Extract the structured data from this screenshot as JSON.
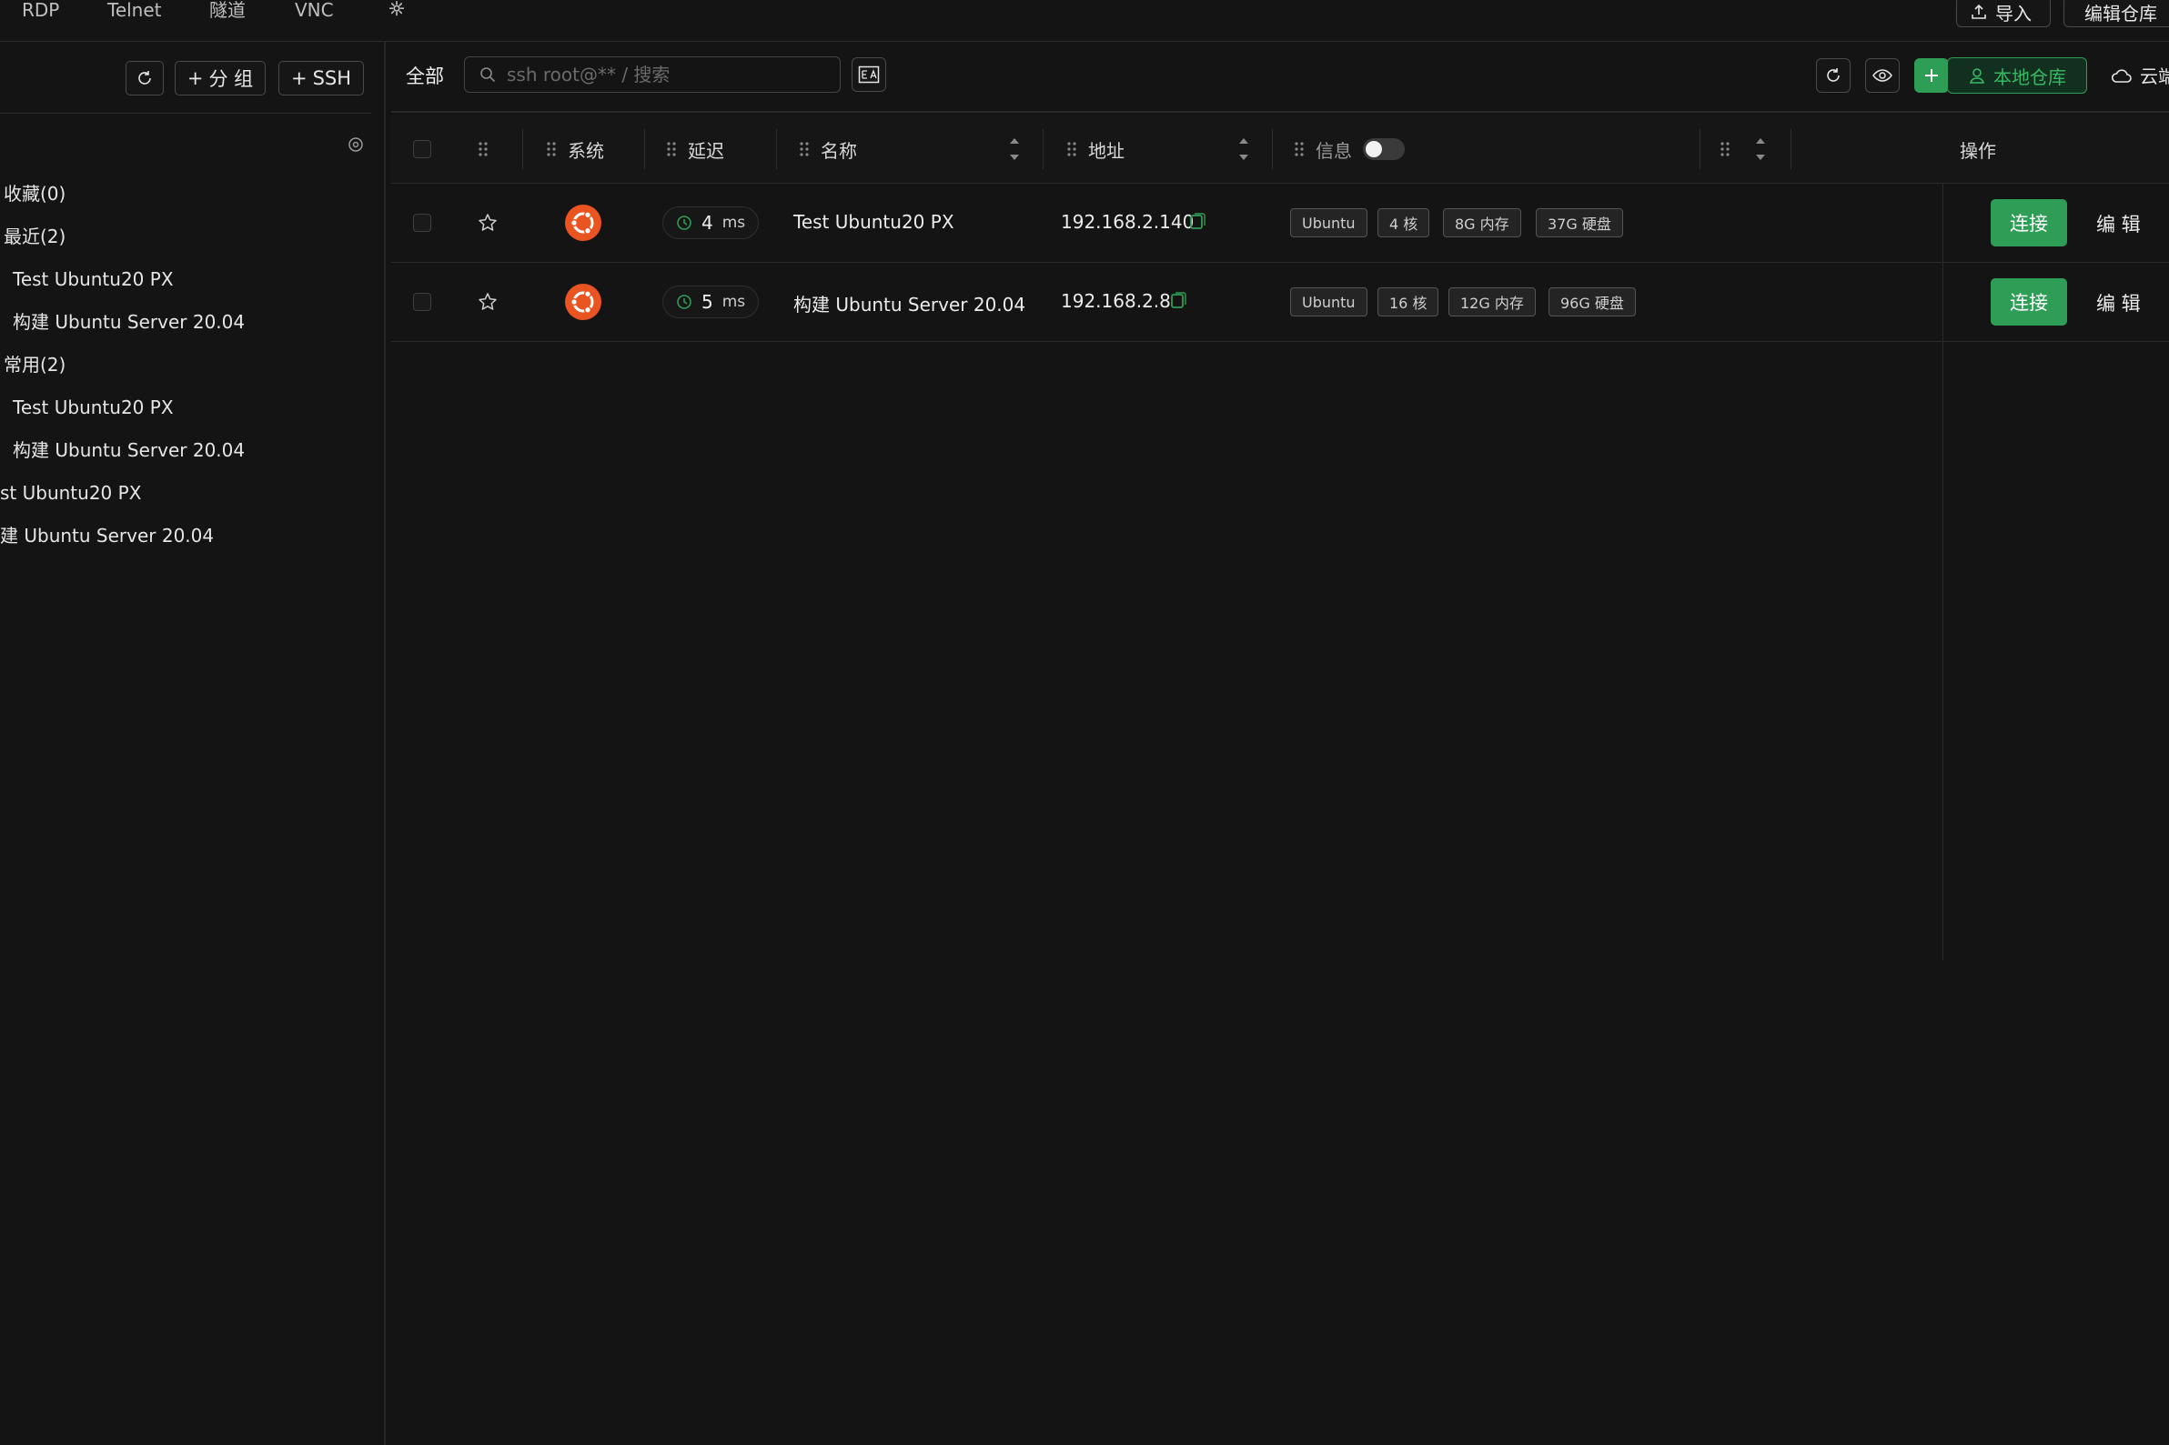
{
  "top_tabs": [
    "RDP",
    "Telnet",
    "隧道",
    "VNC"
  ],
  "top_buttons": {
    "import": "导入",
    "edit_repo": "编辑仓库"
  },
  "sidebar": {
    "add_group": "分 组",
    "add_ssh": "SSH",
    "items": [
      "收藏(0)",
      "最近(2)",
      "Test Ubuntu20 PX",
      "构建 Ubuntu Server 20.04",
      "常用(2)",
      "Test Ubuntu20 PX",
      "构建 Ubuntu Server 20.04",
      "st Ubuntu20 PX",
      "建 Ubuntu Server 20.04"
    ]
  },
  "toolbar": {
    "filter_all": "全部",
    "search_placeholder": "ssh root@** / 搜索",
    "local_repo": "本地仓库",
    "cloud_repo": "云端仓库"
  },
  "table": {
    "headers": {
      "system": "系统",
      "latency": "延迟",
      "name": "名称",
      "address": "地址",
      "info": "信息",
      "actions": "操作"
    },
    "rows": [
      {
        "latency_value": "4",
        "latency_unit": "ms",
        "name": "Test Ubuntu20 PX",
        "address": "192.168.2.140",
        "tags": [
          "Ubuntu",
          "4 核",
          "8G 内存",
          "37G 硬盘"
        ],
        "connect": "连接",
        "edit": "编 辑"
      },
      {
        "latency_value": "5",
        "latency_unit": "ms",
        "name": "构建 Ubuntu Server 20.04",
        "address": "192.168.2.8",
        "tags": [
          "Ubuntu",
          "16 核",
          "12G 内存",
          "96G 硬盘"
        ],
        "connect": "连接",
        "edit": "编 辑"
      }
    ]
  },
  "colors": {
    "accent": "#2e9d55",
    "background": "#141414",
    "ubuntu": "#e95420"
  }
}
